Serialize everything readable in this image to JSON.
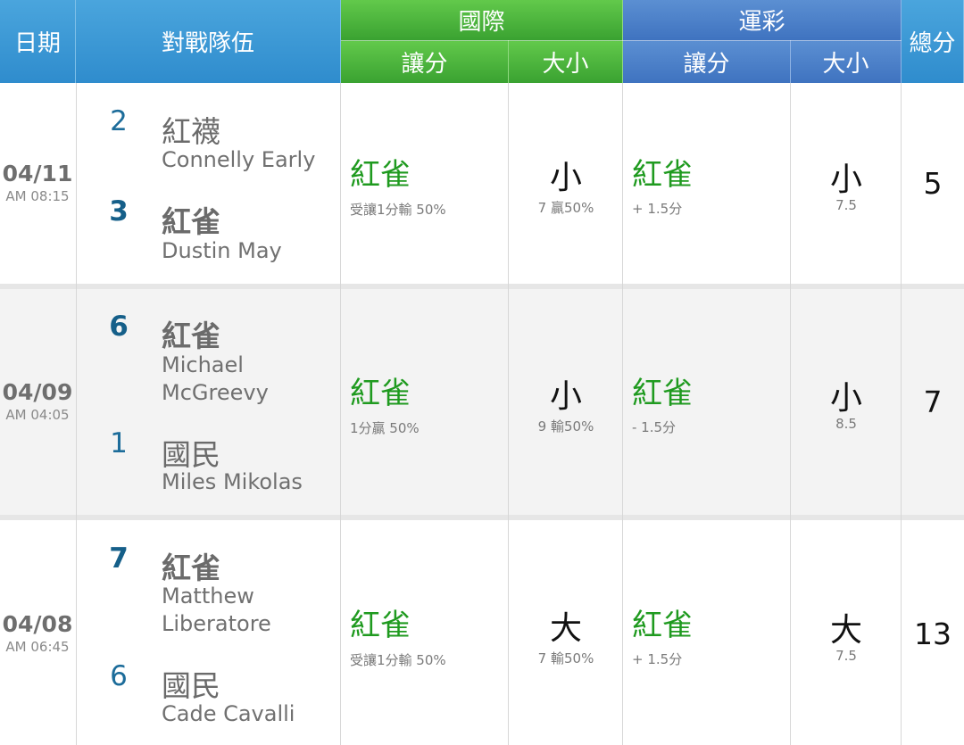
{
  "header": {
    "date": "日期",
    "teams": "對戰隊伍",
    "intl": "國際",
    "intl_spread": "讓分",
    "intl_ou": "大小",
    "lottery": "運彩",
    "lottery_spread": "讓分",
    "lottery_ou": "大小",
    "total": "總分"
  },
  "games": [
    {
      "date": "04/11",
      "time": "AM 08:15",
      "away": {
        "score": "2",
        "team": "紅襪",
        "pitcher": "Connelly Early"
      },
      "home": {
        "score": "3",
        "team": "紅雀",
        "pitcher": "Dustin May"
      },
      "intl_pick": "紅雀",
      "intl_note": "受讓1分輸 50%",
      "intl_ou": "小",
      "intl_ou_note": "7  贏50%",
      "lottery_pick": "紅雀",
      "lottery_note": "+ 1.5分",
      "lottery_ou": "小",
      "lottery_ou_note": "7.5",
      "total": "5"
    },
    {
      "date": "04/09",
      "time": "AM 04:05",
      "away": {
        "score": "6",
        "team": "紅雀",
        "pitcher": "Michael McGreevy"
      },
      "home": {
        "score": "1",
        "team": "國民",
        "pitcher": "Miles Mikolas"
      },
      "intl_pick": "紅雀",
      "intl_note": "1分贏 50%",
      "intl_ou": "小",
      "intl_ou_note": "9  輸50%",
      "lottery_pick": "紅雀",
      "lottery_note": "- 1.5分",
      "lottery_ou": "小",
      "lottery_ou_note": "8.5",
      "total": "7"
    },
    {
      "date": "04/08",
      "time": "AM 06:45",
      "away": {
        "score": "7",
        "team": "紅雀",
        "pitcher": "Matthew Liberatore"
      },
      "home": {
        "score": "6",
        "team": "國民",
        "pitcher": "Cade Cavalli"
      },
      "intl_pick": "紅雀",
      "intl_note": "受讓1分輸 50%",
      "intl_ou": "大",
      "intl_ou_note": "7  輸50%",
      "lottery_pick": "紅雀",
      "lottery_note": "+ 1.5分",
      "lottery_ou": "大",
      "lottery_ou_note": "7.5",
      "total": "13"
    }
  ]
}
